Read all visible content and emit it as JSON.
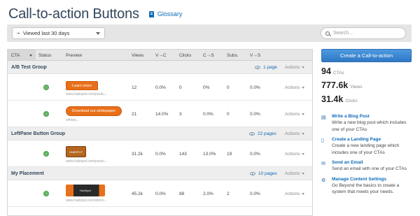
{
  "header": {
    "title": "Call-to-action Buttons",
    "glossary": "Glossary"
  },
  "filter": {
    "selected": "Viewed last 30 days",
    "search_placeholder": "Search..."
  },
  "table": {
    "columns": [
      "CTA",
      "Status",
      "Preview",
      "Views",
      "V→C",
      "Clicks",
      "C→S",
      "Subs.",
      "V→S"
    ],
    "groups": [
      {
        "name": "A/B Test Group",
        "pages": "1 page",
        "actions": "Actions",
        "rows": [
          {
            "preview": "Learn more",
            "url": "www.hubspot.com/produ...",
            "views": "12",
            "vc": "0.0%",
            "clicks": "0",
            "cs": "0%",
            "subs": "0",
            "vs": "0.0%",
            "actions": "Actions"
          },
          {
            "preview": "Download our whitepaper",
            "url": "whitep...",
            "views": "21",
            "vc": "14.0%",
            "clicks": "3",
            "cs": "0.0%",
            "subs": "0",
            "vs": "0.0%",
            "actions": "Actions"
          }
        ]
      },
      {
        "name": "LeftPane Button Group",
        "pages": "22 pages",
        "actions": "Actions",
        "rows": [
          {
            "preview": "HUBSPOT",
            "url": "www.hubspot.com/produ...",
            "views": "31.2k",
            "vc": "0.0%",
            "clicks": "143",
            "cs": "13.0%",
            "subs": "19",
            "vs": "0.0%",
            "actions": "Actions"
          }
        ]
      },
      {
        "name": "My Placement",
        "pages": "10 pages",
        "actions": "Actions",
        "rows": [
          {
            "preview": "HubSpot",
            "url": "www.hubspot.com/demo...",
            "views": "45.2k",
            "vc": "0.0%",
            "clicks": "88",
            "cs": "2.0%",
            "subs": "2",
            "vs": "0.0%",
            "actions": "Actions"
          }
        ]
      }
    ]
  },
  "sidebar": {
    "create_label": "Create a Call-to-action",
    "stats": [
      {
        "num": "94",
        "label": "CTAs"
      },
      {
        "num": "777.6k",
        "label": "Views"
      },
      {
        "num": "31.4k",
        "label": "Clicks"
      }
    ],
    "links": [
      {
        "icon": "blog-icon",
        "title": "Write a Blog Post",
        "desc": "Write a new blog post which includes one of your CTAs"
      },
      {
        "icon": "page-icon",
        "title": "Create a Landing Page",
        "desc": "Create a new landing page which includes one of your CTAs"
      },
      {
        "icon": "email-icon",
        "title": "Send an Email",
        "desc": "Send an email with one of your CTAs"
      },
      {
        "icon": "gear-icon",
        "title": "Manage Content Settings",
        "desc": "Go Beyond the basics to create a system that meets your needs."
      }
    ]
  },
  "colors": {
    "accent": "#0c6ab8",
    "status_green": "#6bb86b",
    "preview_orange": "#e8701a"
  }
}
